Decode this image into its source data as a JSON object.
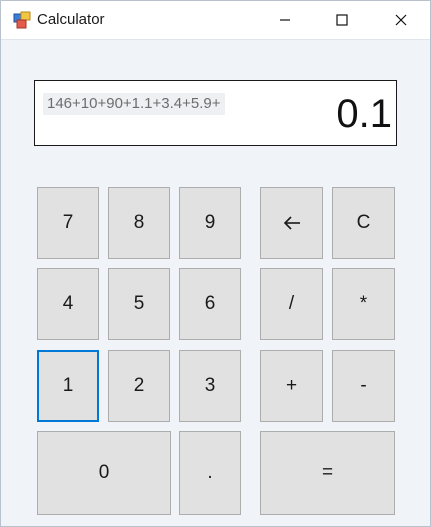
{
  "window": {
    "title": "Calculator",
    "icon": "calculator-app-icon",
    "controls": {
      "minimize": "minimize-icon",
      "maximize": "maximize-icon",
      "close": "close-icon"
    }
  },
  "display": {
    "expression": "146+10+90+1.1+3.4+5.9+",
    "value": "0.1"
  },
  "keys": {
    "seven": "7",
    "eight": "8",
    "nine": "9",
    "backspace_icon": "backspace-arrow-icon",
    "clear": "C",
    "four": "4",
    "five": "5",
    "six": "6",
    "divide": "/",
    "multiply": "*",
    "one": "1",
    "two": "2",
    "three": "3",
    "plus": "+",
    "minus": "-",
    "zero": "0",
    "dot": ".",
    "equals": "="
  },
  "colors": {
    "focus_border": "#0078d7",
    "key_face": "#e1e1e1",
    "window_bg": "#f0f4f9"
  }
}
